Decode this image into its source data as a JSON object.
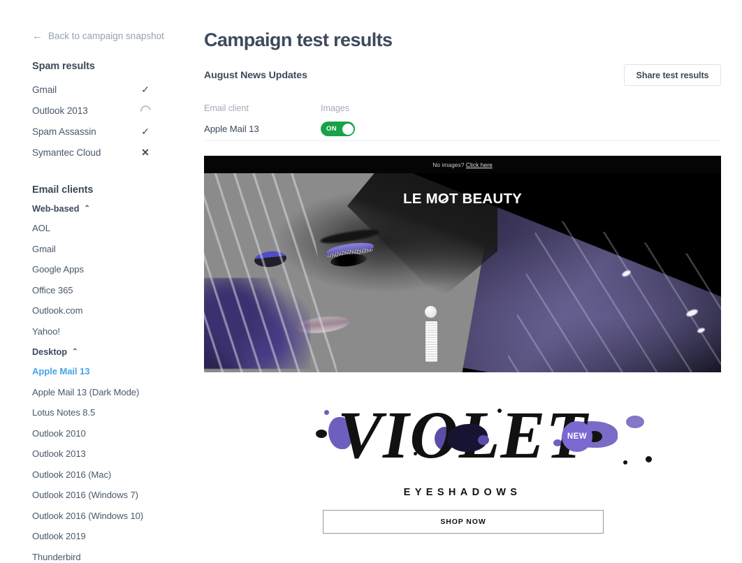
{
  "sidebar": {
    "back_link": {
      "label": "Back to campaign snapshot",
      "icon": "arrow-left-icon"
    },
    "spam": {
      "title": "Spam results",
      "rows": [
        {
          "name": "Gmail",
          "status": "check",
          "glyph": "✓"
        },
        {
          "name": "Outlook 2013",
          "status": "loading",
          "glyph": ""
        },
        {
          "name": "Spam Assassin",
          "status": "check",
          "glyph": "✓"
        },
        {
          "name": "Symantec Cloud",
          "status": "fail",
          "glyph": "✕"
        }
      ]
    },
    "clients": {
      "title": "Email clients",
      "groups": [
        {
          "label": "Web-based",
          "chevron": "⌃",
          "expanded": true,
          "items": [
            {
              "label": "AOL",
              "active": false
            },
            {
              "label": "Gmail",
              "active": false
            },
            {
              "label": "Google Apps",
              "active": false
            },
            {
              "label": "Office 365",
              "active": false
            },
            {
              "label": "Outlook.com",
              "active": false
            },
            {
              "label": "Yahoo!",
              "active": false
            }
          ]
        },
        {
          "label": "Desktop",
          "chevron": "⌃",
          "expanded": true,
          "items": [
            {
              "label": "Apple Mail 13",
              "active": true
            },
            {
              "label": "Apple Mail 13 (Dark Mode)",
              "active": false
            },
            {
              "label": "Lotus Notes 8.5",
              "active": false
            },
            {
              "label": "Outlook 2010",
              "active": false
            },
            {
              "label": "Outlook 2013",
              "active": false
            },
            {
              "label": "Outlook 2016 (Mac)",
              "active": false
            },
            {
              "label": "Outlook 2016 (Windows 7)",
              "active": false
            },
            {
              "label": "Outlook 2016 (Windows 10)",
              "active": false
            },
            {
              "label": "Outlook 2019",
              "active": false
            },
            {
              "label": "Thunderbird",
              "active": false
            }
          ]
        }
      ]
    }
  },
  "main": {
    "page_title": "Campaign test results",
    "campaign_name": "August News Updates",
    "share_button": "Share test results",
    "meta": {
      "col_client_header": "Email client",
      "col_images_header": "Images",
      "client_value": "Apple Mail 13",
      "images_toggle": {
        "label": "ON",
        "state": "on"
      }
    }
  },
  "email_preview": {
    "preheader": {
      "text": "No images? ",
      "link": "Click here"
    },
    "hero": {
      "logo_before": "LE M",
      "logo_o": "O",
      "logo_after": "T BEAUTY"
    },
    "product": {
      "title": "VIOLET",
      "badge": "NEW",
      "subtitle": "EYESHADOWS",
      "cta": "SHOP NOW"
    }
  },
  "colors": {
    "accent_blue": "#44a6e8",
    "text_dark": "#3d4a5c",
    "text_muted": "#a3abb7",
    "toggle_green": "#18a24a",
    "badge_purple": "#7b68d1"
  }
}
